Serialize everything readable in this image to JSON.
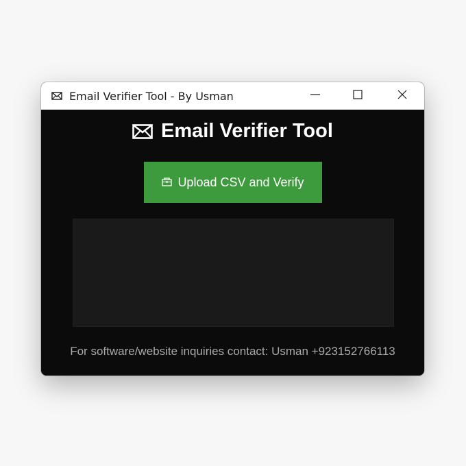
{
  "window": {
    "title": "Email Verifier Tool - By Usman",
    "controls": {
      "minimize": "minimize-icon",
      "maximize": "maximize-icon",
      "close": "close-icon"
    }
  },
  "app": {
    "heading": "Email Verifier Tool",
    "heading_icon": "envelope-icon",
    "upload_button": {
      "label": "Upload CSV and Verify",
      "icon": "folder-icon",
      "color": "#3d9b3d"
    },
    "log_text": "",
    "footer": "For software/website inquiries contact: Usman +923152766113"
  },
  "colors": {
    "background": "#0b0b0b",
    "panel": "#1a1a1a",
    "accent": "#3d9b3d",
    "footer_text": "#a9a9a9"
  }
}
